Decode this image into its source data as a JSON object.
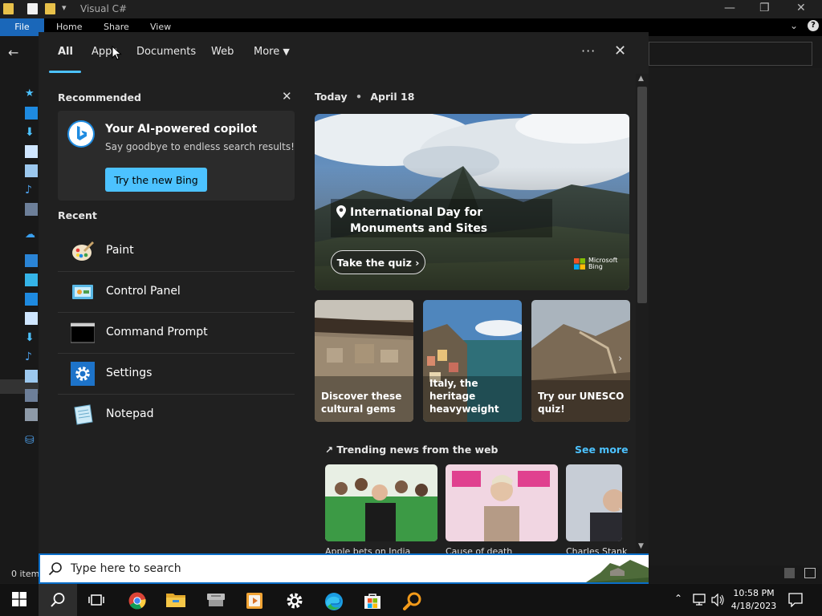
{
  "window": {
    "title": "Visual C#"
  },
  "ribbon": {
    "file": "File",
    "tabs": [
      "Home",
      "Share",
      "View"
    ]
  },
  "status": {
    "items": "0 item"
  },
  "search": {
    "tabs": [
      "All",
      "Apps",
      "Documents",
      "Web",
      "More"
    ],
    "active_tab": "All",
    "recommended_label": "Recommended",
    "promo": {
      "title": "Your AI-powered copilot",
      "subtitle": "Say goodbye to endless search results!",
      "button": "Try the new Bing"
    },
    "recent_label": "Recent",
    "recent": [
      {
        "label": "Paint",
        "icon": "paint-icon"
      },
      {
        "label": "Control Panel",
        "icon": "control-panel-icon"
      },
      {
        "label": "Command Prompt",
        "icon": "command-prompt-icon"
      },
      {
        "label": "Settings",
        "icon": "settings-icon"
      },
      {
        "label": "Notepad",
        "icon": "notepad-icon"
      }
    ],
    "today": {
      "label": "Today",
      "date": "April 18"
    },
    "hero": {
      "title": "International Day for Monuments and Sites",
      "button": "Take the quiz",
      "brand": "Microsoft Bing"
    },
    "cards": [
      "Discover these cultural gems",
      "Italy, the heritage heavyweight",
      "Try our UNESCO quiz!"
    ],
    "trending_label": "Trending news from the web",
    "see_more": "See more",
    "news": [
      "Apple bets on India",
      "Cause of death",
      "Charles Stank"
    ],
    "placeholder": "Type here to search"
  },
  "taskbar": {
    "apps": [
      "start-icon",
      "search-icon",
      "task-view-icon",
      "chrome-icon",
      "file-explorer-icon",
      "app-icon",
      "media-icon",
      "settings-icon",
      "edge-icon",
      "store-icon",
      "search-tool-icon"
    ],
    "time": "10:58 PM",
    "date": "4/18/2023"
  },
  "colors": {
    "accent": "#4cc2ff",
    "flyout_bg": "#202020",
    "taskbar_bg": "#121212",
    "file_tab": "#1a67b9"
  }
}
